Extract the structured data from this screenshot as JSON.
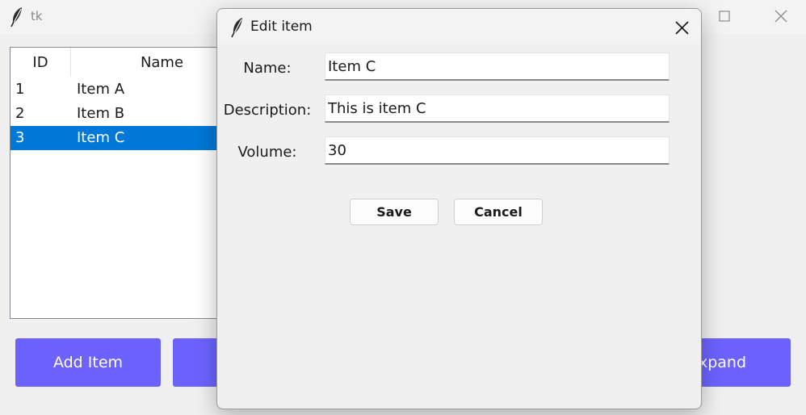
{
  "main_window": {
    "title": "tk",
    "icons": {
      "app": "feather-icon",
      "maximize": "maximize-icon",
      "close": "close-icon"
    },
    "tree": {
      "columns": [
        "ID",
        "Name"
      ],
      "rows": [
        {
          "id": "1",
          "name": "Item A",
          "selected": false
        },
        {
          "id": "2",
          "name": "Item B",
          "selected": false
        },
        {
          "id": "3",
          "name": "Item C",
          "selected": true
        }
      ]
    },
    "buttons": {
      "add_item": "Add Item",
      "expand": "Expand"
    },
    "colors": {
      "button_bg": "#6c63ff",
      "selection": "#0078d7"
    }
  },
  "dialog": {
    "title": "Edit item",
    "icons": {
      "app": "feather-icon",
      "close": "close-icon"
    },
    "fields": {
      "name": {
        "label": "Name:",
        "value": "Item C"
      },
      "description": {
        "label": "Description:",
        "value": "This is item C"
      },
      "volume": {
        "label": "Volume:",
        "value": "30"
      }
    },
    "save_label": "Save",
    "cancel_label": "Cancel"
  }
}
